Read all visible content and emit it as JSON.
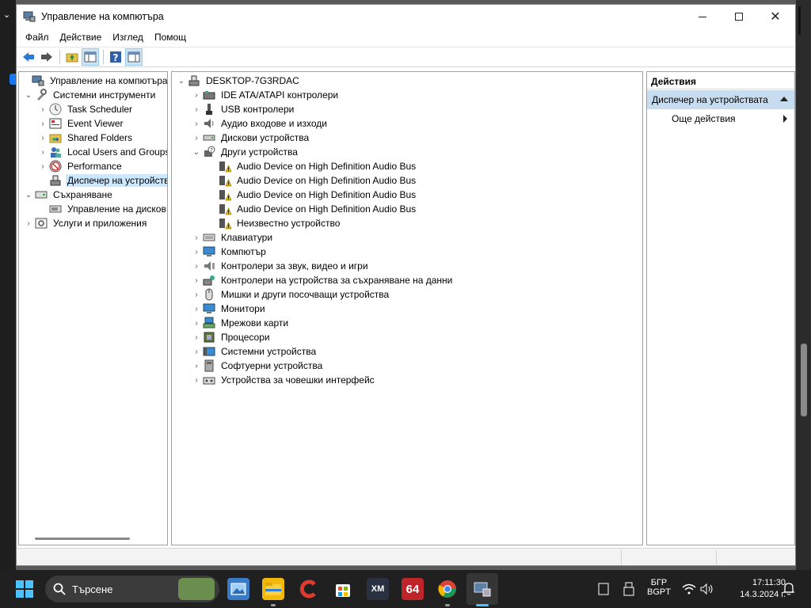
{
  "window": {
    "title": "Управление на компютъра",
    "menu": [
      "Файл",
      "Действие",
      "Изглед",
      "Помощ"
    ],
    "toolbar_icons": [
      "back-arrow-icon",
      "forward-arrow-icon",
      "up-folder-icon",
      "show-hide-tree-icon",
      "help-icon",
      "show-hide-action-pane-icon"
    ]
  },
  "left_tree": {
    "root": "Управление на компютъра (л",
    "system_tools": "Системни инструменти",
    "task_scheduler": "Task Scheduler",
    "event_viewer": "Event Viewer",
    "shared_folders": "Shared Folders",
    "local_users": "Local Users and Groups",
    "performance": "Performance",
    "device_manager": "Диспечер на устройств",
    "storage": "Съхраняване",
    "disk_management": "Управление на дисков",
    "services": "Услуги и приложения"
  },
  "device_tree": {
    "computer": "DESKTOP-7G3RDAC",
    "categories_top": [
      {
        "label": "IDE ATA/ATAPI контролери",
        "icon": "ide-controller-icon"
      },
      {
        "label": "USB контролери",
        "icon": "usb-icon"
      },
      {
        "label": "Аудио входове и изходи",
        "icon": "speaker-icon"
      },
      {
        "label": "Дискови устройства",
        "icon": "disk-drive-icon"
      }
    ],
    "other_devices": "Други устройства",
    "other_children": [
      "Audio Device on High Definition Audio Bus",
      "Audio Device on High Definition Audio Bus",
      "Audio Device on High Definition Audio Bus",
      "Audio Device on High Definition Audio Bus",
      "Неизвестно устройство"
    ],
    "categories_bottom": [
      {
        "label": "Клавиатури",
        "icon": "keyboard-icon"
      },
      {
        "label": "Компютър",
        "icon": "computer-icon"
      },
      {
        "label": "Контролери за звук, видео и игри",
        "icon": "sound-controller-icon"
      },
      {
        "label": "Контролери на устройства за съхраняване на данни",
        "icon": "storage-controller-icon"
      },
      {
        "label": "Мишки и други посочващи устройства",
        "icon": "mouse-icon"
      },
      {
        "label": "Монитори",
        "icon": "monitor-icon"
      },
      {
        "label": "Мрежови карти",
        "icon": "network-adapter-icon"
      },
      {
        "label": "Процесори",
        "icon": "processor-icon"
      },
      {
        "label": "Системни устройства",
        "icon": "system-devices-icon"
      },
      {
        "label": "Софтуерни устройства",
        "icon": "software-device-icon"
      },
      {
        "label": "Устройства за човешки интерфейс",
        "icon": "hid-icon"
      }
    ]
  },
  "actions": {
    "header": "Действия",
    "section": "Диспечер на устройствата",
    "more": "Още действия"
  },
  "taskbar": {
    "search_label": "Търсене",
    "lang_top": "БГР",
    "lang_bottom": "BGPT",
    "time": "17:11:30",
    "date": "14.3.2024 г.",
    "apps": [
      "photos-icon",
      "file-explorer-icon",
      "ccleaner-icon",
      "microsoft-store-icon",
      "xmplay-icon",
      "aida64-icon",
      "chrome-icon",
      "computer-management-icon"
    ],
    "app64_label": "64",
    "xm_label": "XM"
  },
  "colors": {
    "selection": "#cce8ff",
    "action_section": "#c7dcef",
    "taskbar": "#202020",
    "accent": "#4cc2ff"
  }
}
